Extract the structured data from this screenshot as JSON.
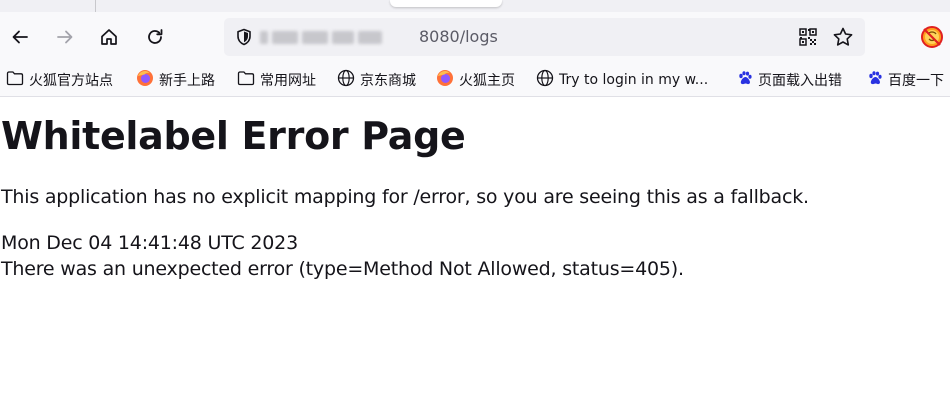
{
  "browser": {
    "address_bar": {
      "url_visible_suffix": "8080/logs"
    },
    "bookmarks": [
      {
        "label": "火狐官方站点",
        "icon": "folder-icon"
      },
      {
        "label": "新手上路",
        "icon": "firefox-icon"
      },
      {
        "label": "常用网址",
        "icon": "folder-icon"
      },
      {
        "label": "京东商城",
        "icon": "globe-icon"
      },
      {
        "label": "火狐主页",
        "icon": "firefox-icon"
      },
      {
        "label": "Try to login in my w...",
        "icon": "globe-icon"
      },
      {
        "label": "页面载入出错",
        "icon": "baidu-paw-icon"
      },
      {
        "label": "百度一下",
        "icon": "baidu-paw-icon"
      }
    ]
  },
  "page": {
    "title": "Whitelabel Error Page",
    "description": "This application has no explicit mapping for /error, so you are seeing this as a fallback.",
    "timestamp": "Mon Dec 04 14:41:48 UTC 2023",
    "error_message": "There was an unexpected error (type=Method Not Allowed, status=405)."
  },
  "colors": {
    "toolbar_bg": "#f9f9fb",
    "urlbar_bg": "#f0f0f4",
    "text": "#15141a",
    "firefox_orange": "#ff7139",
    "baidu_blue": "#2932e1"
  }
}
